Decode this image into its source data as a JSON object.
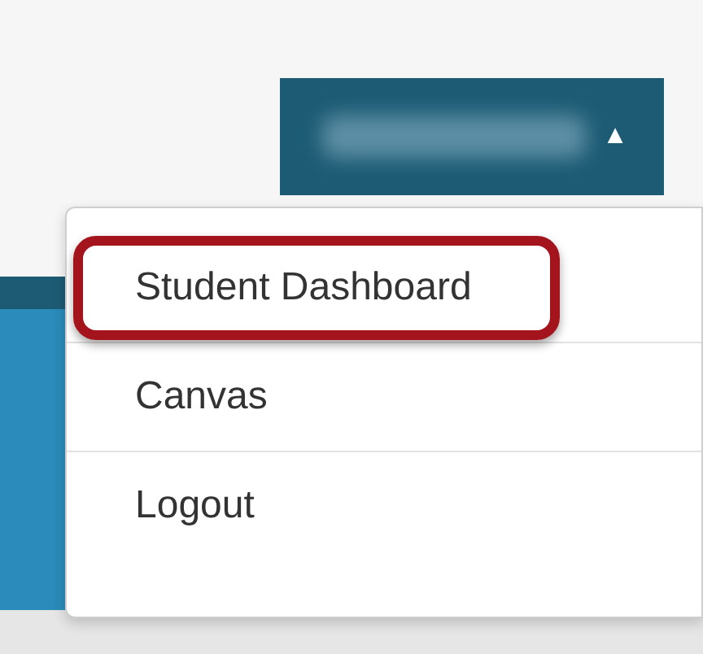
{
  "account_button": {
    "caret": "▲"
  },
  "menu": {
    "items": [
      {
        "label": "Student Dashboard",
        "highlighted": true
      },
      {
        "label": "Canvas",
        "highlighted": false
      },
      {
        "label": "Logout",
        "highlighted": false
      }
    ]
  }
}
